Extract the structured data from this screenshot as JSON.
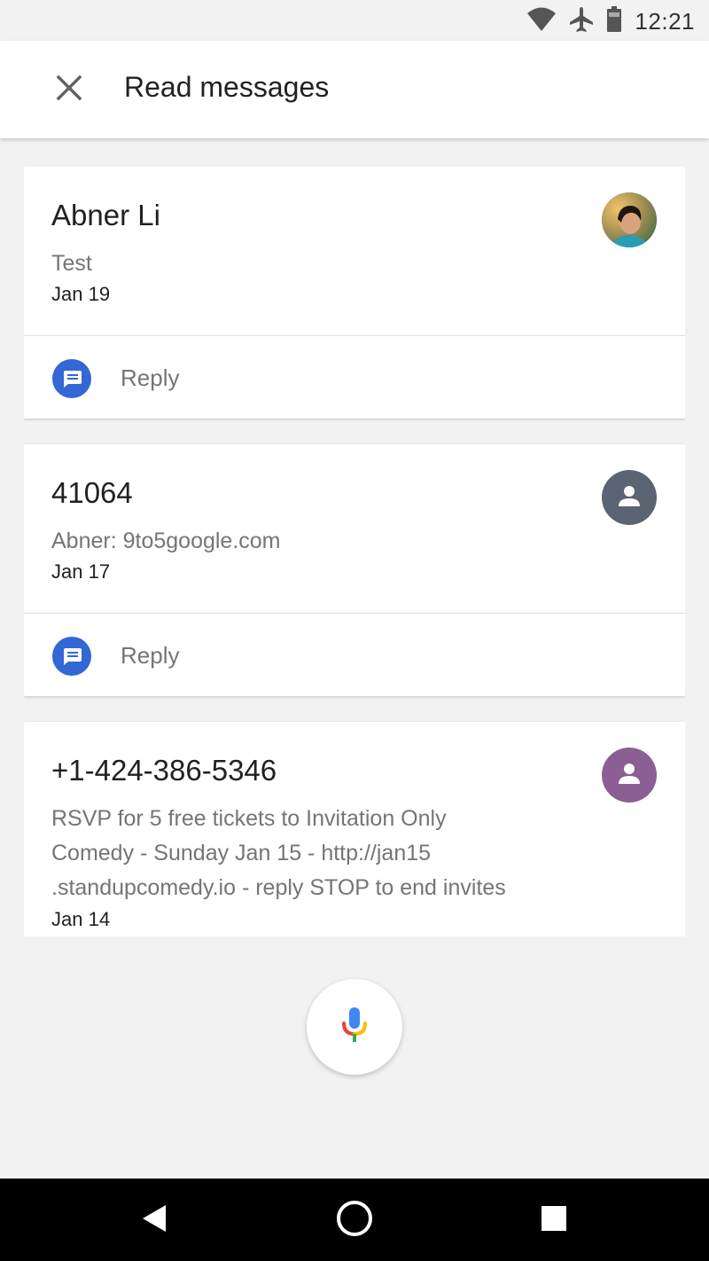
{
  "status_bar": {
    "time": "12:21",
    "icons": [
      "wifi-icon",
      "airplane-mode-icon",
      "battery-icon"
    ]
  },
  "app_bar": {
    "title": "Read messages",
    "close_icon": "close-icon"
  },
  "messages": [
    {
      "sender": "Abner Li",
      "preview": "Test",
      "date": "Jan 19",
      "avatar": "photo",
      "reply_label": "Reply"
    },
    {
      "sender": "41064",
      "preview": "Abner: 9to5google.com",
      "date": "Jan 17",
      "avatar": "person-icon",
      "avatar_color": "#5a6472",
      "reply_label": "Reply"
    },
    {
      "sender": "+1-424-386-5346",
      "preview_lines": [
        "RSVP for 5 free tickets to Invitation Only",
        "Comedy - Sunday Jan 15 - http://jan15",
        ".standupcomedy.io - reply STOP to end invites"
      ],
      "date": "Jan 14",
      "avatar": "person-icon",
      "avatar_color": "#8b5f93"
    }
  ],
  "assistant": {
    "mic_icon": "microphone-icon"
  },
  "nav_bar": {
    "buttons": [
      "back-icon",
      "home-icon",
      "recents-icon"
    ]
  },
  "colors": {
    "background": "#f2f2f2",
    "card": "#ffffff",
    "reply_icon": "#3367d6",
    "secondary_text": "#757575"
  }
}
